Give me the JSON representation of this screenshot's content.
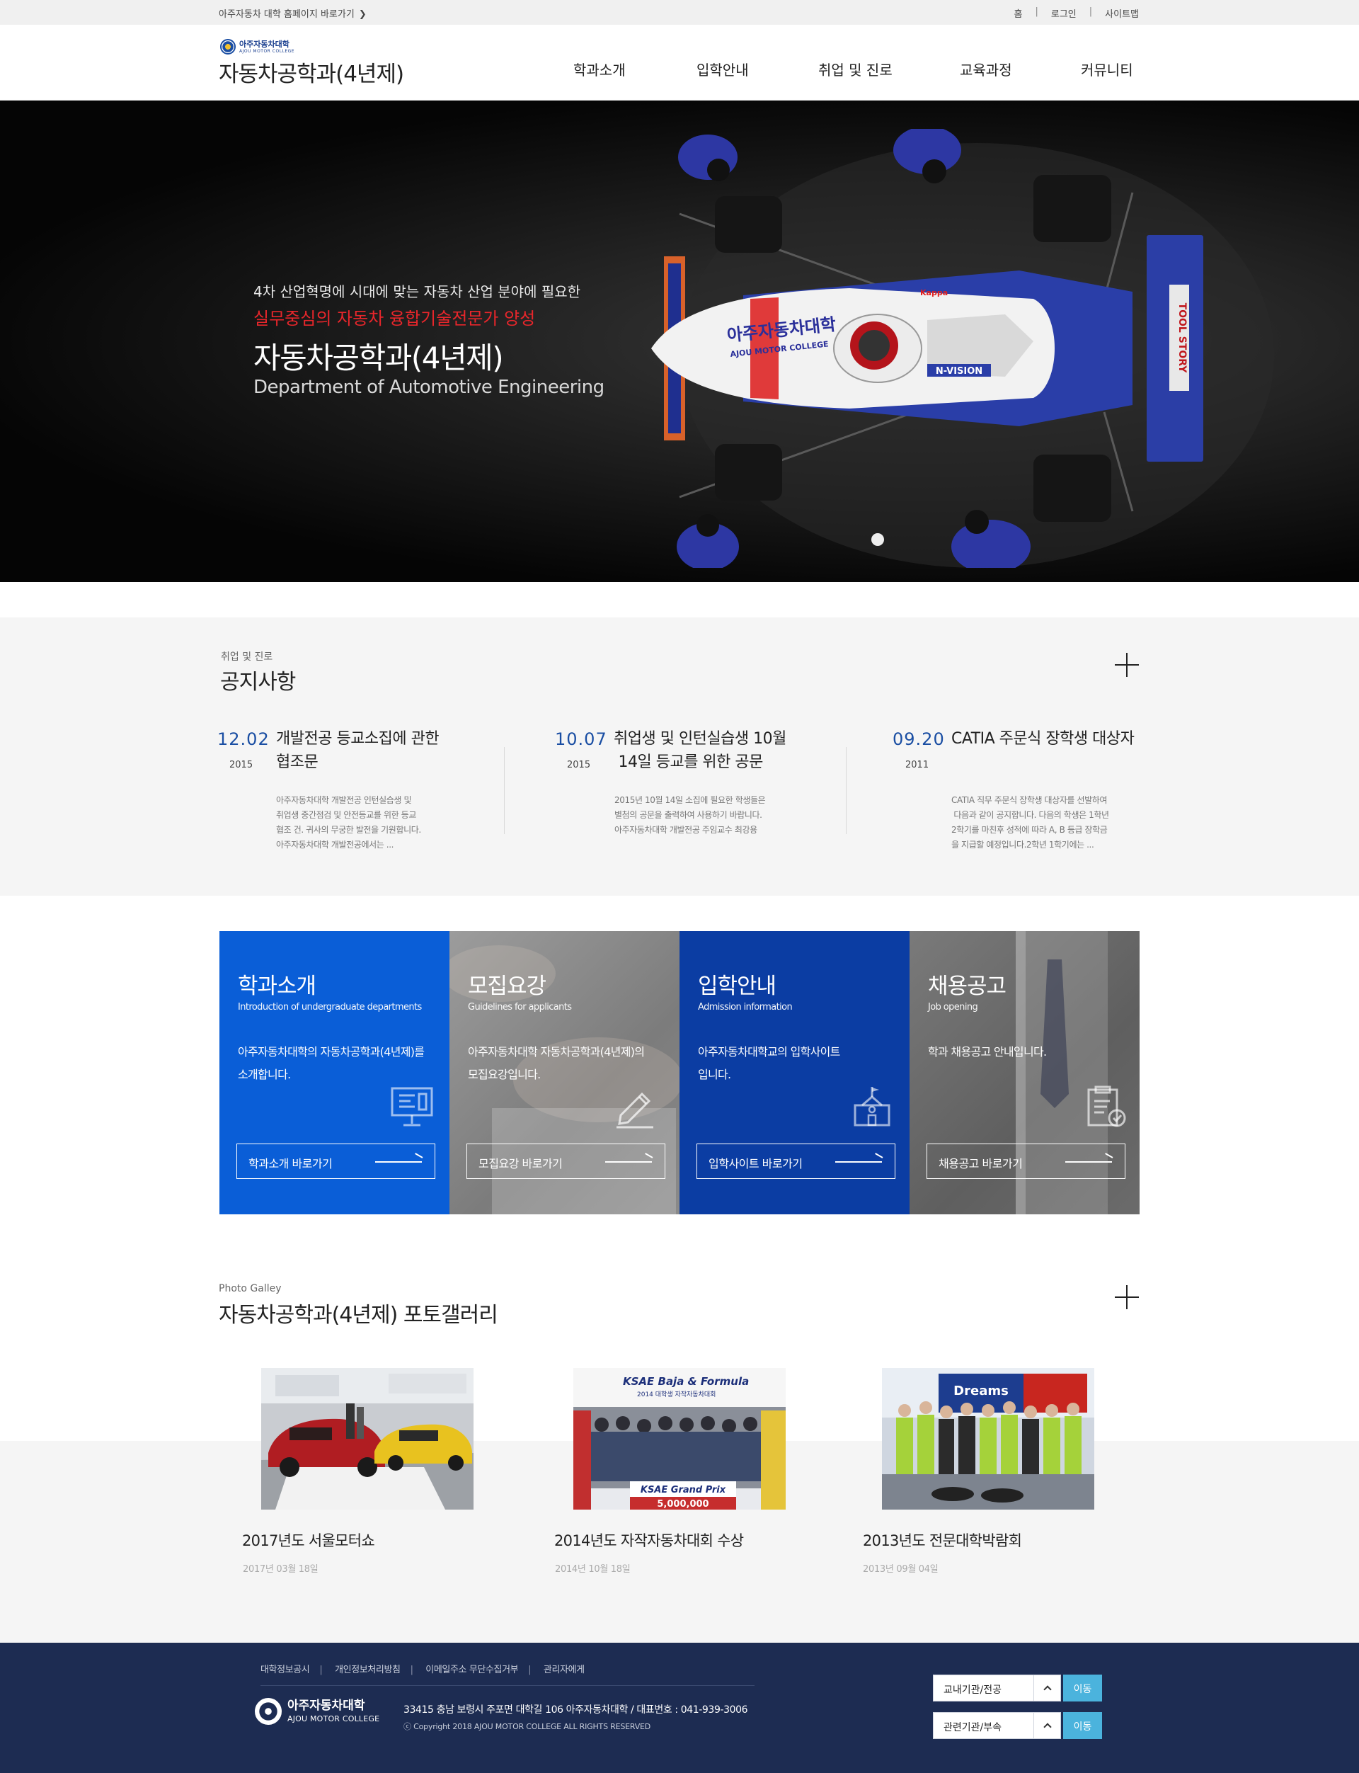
{
  "topbar": {
    "home_link": "아주자동차 대학 홈페이지 바로가기",
    "links": [
      "홈",
      "로그인",
      "사이트맵"
    ]
  },
  "header": {
    "logo_ko": "아주자동차대학",
    "logo_en": "AJOU MOTOR COLLEGE",
    "title": "자동차공학과(4년제)",
    "nav": [
      "학과소개",
      "입학안내",
      "취업 및 진로",
      "교육과정",
      "커뮤니티"
    ]
  },
  "hero": {
    "subtitle": "4차 산업혁명에 시대에 맞는 자동차 산업 분야에 필요한",
    "highlight": "실무중심의 자동차 융합기술전문가 양성",
    "title": "자동차공학과(4년제)",
    "english": "Department of Automotive Engineering",
    "car_text_ko": "아주자동차대학",
    "car_text_en": "AJOU MOTOR COLLEGE",
    "car_brand": "N-VISION",
    "wing_text": "TOOL STORY",
    "nose_text": "Kappa"
  },
  "notice": {
    "small": "취업 및 진로",
    "title": "공지사항",
    "items": [
      {
        "date": "12.02",
        "year": "2015",
        "title1": "개발전공 등교소집에 관한",
        "title2": "협조문",
        "body": [
          "아주자동차대학 개발전공 인턴실습생 및",
          "취업생 중간점검 및 안전등교를 위한  등교",
          "협조 건. 귀사의 무궁한 발전을 기원합니다.",
          "아주자동차대학 개발전공에서는 ..."
        ]
      },
      {
        "date": "10.07",
        "year": "2015",
        "title1": "취업생 및 인턴실습생 10월",
        "title2": " 14일 등교를 위한 공문",
        "body": [
          "2015년 10월 14일 소집에 필요한 학생들은",
          "별첨의 공문을 출력하여 사용하기 바랍니다.",
          "아주자동차대학 개발전공 주임교수 최강용"
        ]
      },
      {
        "date": "09.20",
        "year": "2011",
        "title1": "CATIA 주문식 장학생 대상자",
        "title2": "",
        "body": [
          "CATIA 직무 주문식 장학생 대상자를 선발하여",
          " 다음과 같이 공지합니다. 다음의 학생은 1학년",
          "2학기를 마친후 성적에 따라 A, B 등급 장학금",
          "을 지급할 예정입니다.2학년 1학기에는 ..."
        ]
      }
    ]
  },
  "quick": [
    {
      "title": "학과소개",
      "sub": "Introduction of undergraduate departments",
      "desc1": "아주자동차대학의 자동차공학과(4년제)를",
      "desc2": "소개합니다.",
      "button": "학과소개 바로가기",
      "icon": "monitor-board-icon",
      "color": "#0a5ed7"
    },
    {
      "title": "모집요강",
      "sub": "Guidelines for applicants",
      "desc1": "아주자동차대학 자동차공학과(4년제)의",
      "desc2": "모집요강입니다.",
      "button": "모집요강 바로가기",
      "icon": "pencil-icon",
      "color": "#8a8a8a"
    },
    {
      "title": "입학안내",
      "sub": "Admission information",
      "desc1": "아주자동차대학교의 입학사이트",
      "desc2": "입니다.",
      "button": "입학사이트 바로가기",
      "icon": "school-building-icon",
      "color": "#0b3da3"
    },
    {
      "title": "채용공고",
      "sub": "Job opening",
      "desc1": "학과 채용공고 안내입니다.",
      "desc2": "",
      "button": "채용공고 바로가기",
      "icon": "clipboard-check-icon",
      "color": "#6d6d6d"
    }
  ],
  "gallery": {
    "small": "Photo Galley",
    "title": "자동차공학과(4년제) 포토갤러리",
    "items": [
      {
        "title": "2017년도 서울모터쇼",
        "date": "2017년 03월 18일"
      },
      {
        "title": "2014년도 자작자동차대회 수상",
        "date": "2014년 10월 18일",
        "banner1": "KSAE Baja & Formula",
        "banner2": "2014 대학생 자작자동차대회",
        "board1": "KSAE Grand Prix",
        "board2": "5,000,000"
      },
      {
        "title": "2013년도 전문대학박람회",
        "date": "2013년 09월 04일",
        "banner": "Dreams"
      }
    ]
  },
  "footer": {
    "links": [
      "대학정보공시",
      "개인정보처리방침",
      "이메일주소 무단수집거부",
      "관리자에게"
    ],
    "logo_ko": "아주자동차대학",
    "logo_en": "AJOU MOTOR COLLEGE",
    "address": "33415 충남 보령시 주포면 대학길 106 아주자동차대학 / 대표번호 : 041-939-3006",
    "copyright": "ⓒ Copyright 2018  AJOU MOTOR COLLEGE ALL RIGHTS RESERVED",
    "select1": "교내기관/전공",
    "select2": "관련기관/부속",
    "go": "이동"
  }
}
